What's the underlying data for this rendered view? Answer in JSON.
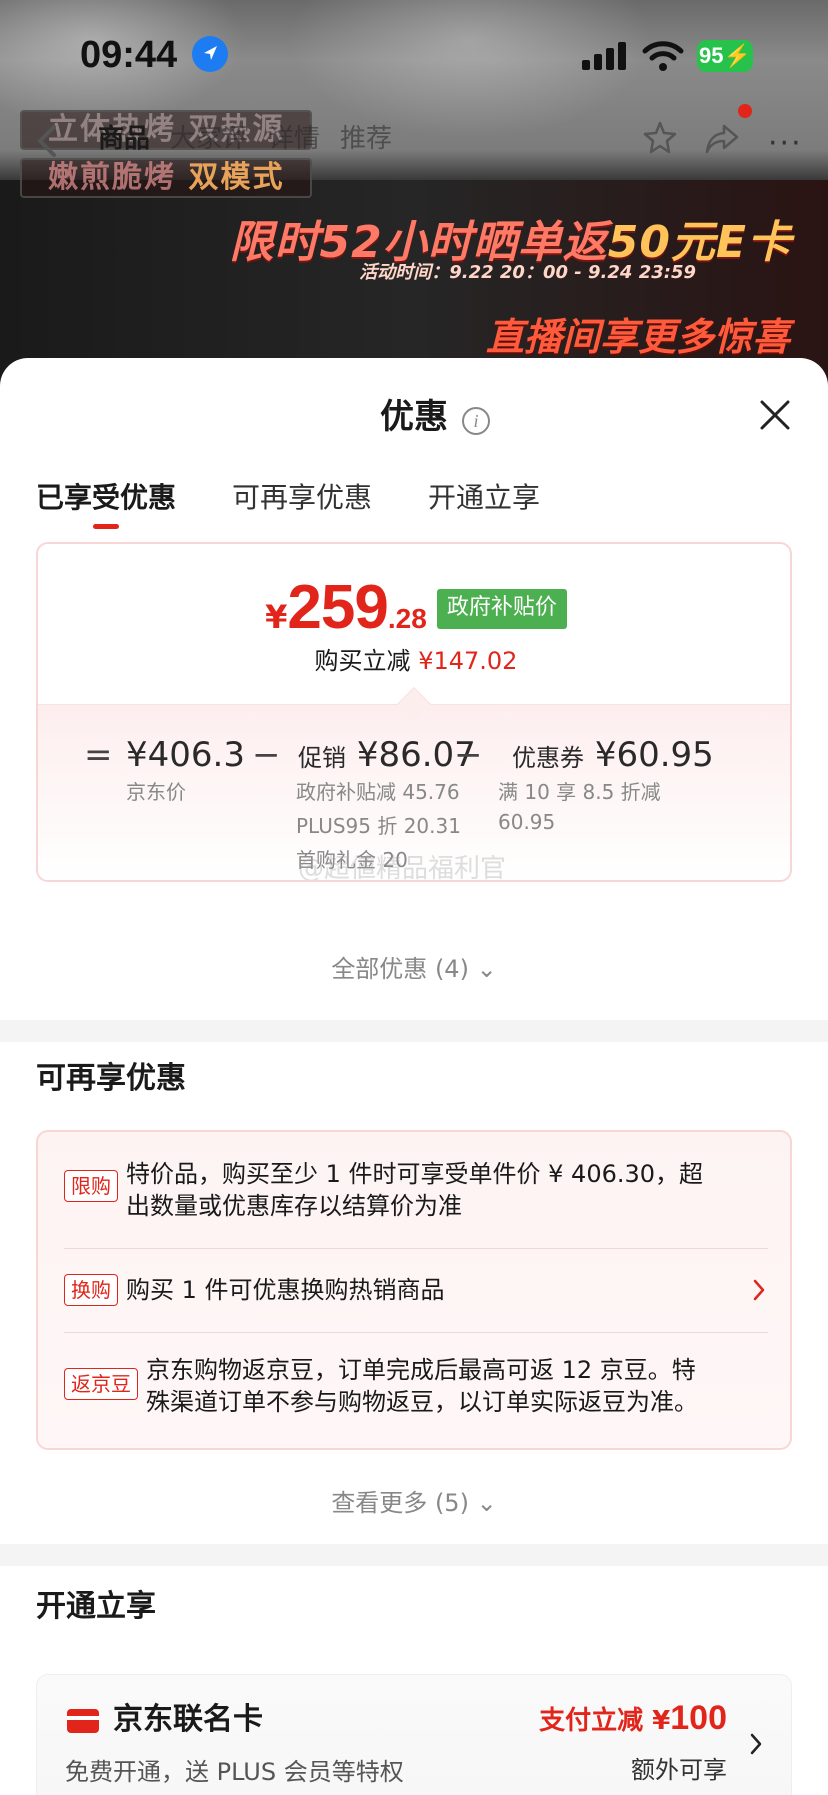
{
  "status_bar": {
    "time": "09:44",
    "battery": "95",
    "icons": [
      "location-arrow-icon",
      "cellular-signal-icon",
      "wifi-icon",
      "battery-charging-icon"
    ]
  },
  "hero": {
    "tagline_1": "立体热烤 双热源",
    "tagline_2_a": "嫩煎脆烤 ",
    "tagline_2_b": "双模式",
    "promo_a": "限时52小时晒单返",
    "promo_b": "50元E卡",
    "promo_time": "活动时间：9.22 20：00 - 9.24 23:59",
    "live": "直播间享更多惊喜"
  },
  "nav": {
    "tabs": [
      "商品",
      "大家评",
      "详情",
      "推荐"
    ],
    "active_tab": "商品",
    "icons": [
      "back-arrow-icon",
      "star-icon",
      "share-icon",
      "more-icon"
    ]
  },
  "sheet": {
    "title": "优惠",
    "tabs": [
      "已享受优惠",
      "可再享优惠",
      "开通立享"
    ],
    "active_tab": "已享受优惠",
    "price": {
      "currency": "¥",
      "integer": "259",
      "decimal": ".28",
      "badge": "政府补贴价",
      "save_label": "购买立减",
      "save_value": "¥147.02"
    },
    "breakdown": {
      "eq": "=",
      "minus": "−",
      "jd_price": "¥406.3",
      "jd_price_label": "京东价",
      "promo_label": "促销",
      "promo_value": "¥86.07",
      "promo_details": [
        "政府补贴减 45.76",
        "PLUS95 折 20.31",
        "首购礼金 20"
      ],
      "coupon_label": "优惠券",
      "coupon_value": "¥60.95",
      "coupon_details": [
        "满 10 享 8.5 折减",
        "60.95"
      ],
      "watermark": "@超値精品福利官"
    },
    "all_offers": "全部优惠 (4)",
    "more_title": "可再享优惠",
    "more_items": [
      {
        "tag": "限购",
        "text": "特价品，购买至少 1 件时可享受单件价 ¥ 406.30，超",
        "text2": "出数量或优惠库存以结算价为准"
      },
      {
        "tag": "换购",
        "text": "购买 1 件可优惠换购热销商品"
      },
      {
        "tag": "返京豆",
        "text": "京东购物返京豆，订单完成后最高可返 12 京豆。特",
        "text2": "殊渠道订单不参与购物返豆，以订单实际返豆为准。"
      }
    ],
    "see_more": "查看更多 (5)",
    "open_title": "开通立享",
    "card": {
      "name": "京东联名卡",
      "desc": "免费开通，送 PLUS 会员等特权",
      "promo_prefix": "支付立减 ¥",
      "promo_amount": "100",
      "extra": "额外可享"
    }
  },
  "colors": {
    "accent_red": "#e1251b",
    "badge_green": "#4caf50",
    "battery_green": "#27c24c",
    "location_blue": "#1e7cf2"
  }
}
